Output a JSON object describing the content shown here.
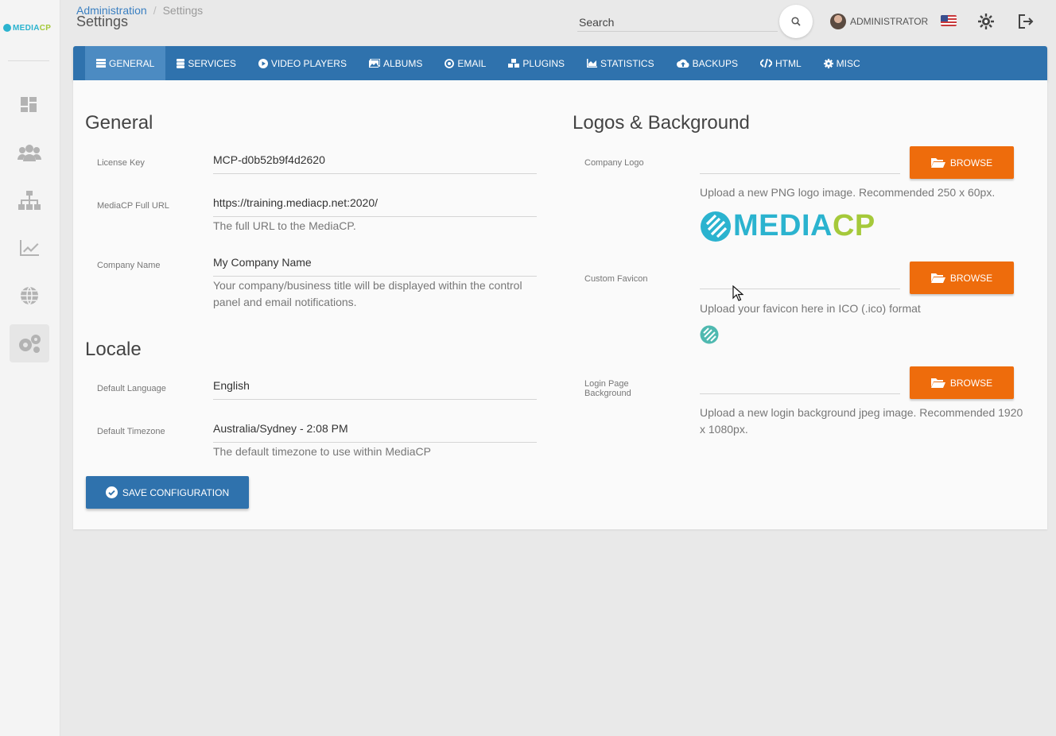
{
  "brand": {
    "name_part1": "MEDIA",
    "name_part2": "CP"
  },
  "sidebar": {
    "items": [
      {
        "name": "dashboard-icon"
      },
      {
        "name": "users-icon"
      },
      {
        "name": "sitemap-icon"
      },
      {
        "name": "chart-icon"
      },
      {
        "name": "globe-icon"
      },
      {
        "name": "cogs-icon",
        "active": true
      }
    ]
  },
  "header": {
    "breadcrumb_parent": "Administration",
    "breadcrumb_separator": "/",
    "breadcrumb_current": "Settings",
    "title": "Settings",
    "search_placeholder": "Search",
    "user_name": "ADMINISTRATOR"
  },
  "tabs": [
    {
      "label": "GENERAL",
      "icon": "list-icon",
      "active": true
    },
    {
      "label": "SERVICES",
      "icon": "server-icon"
    },
    {
      "label": "VIDEO PLAYERS",
      "icon": "play-icon"
    },
    {
      "label": "ALBUMS",
      "icon": "image-icon"
    },
    {
      "label": "EMAIL",
      "icon": "at-icon"
    },
    {
      "label": "PLUGINS",
      "icon": "cubes-icon"
    },
    {
      "label": "STATISTICS",
      "icon": "area-chart-icon"
    },
    {
      "label": "BACKUPS",
      "icon": "cloud-upload-icon"
    },
    {
      "label": "HTML",
      "icon": "code-icon"
    },
    {
      "label": "MISC",
      "icon": "cog-icon"
    }
  ],
  "general": {
    "title": "General",
    "license_key": {
      "label": "License Key",
      "value": "MCP-d0b52b9f4d2620"
    },
    "full_url": {
      "label": "MediaCP Full URL",
      "value": "https://training.mediacp.net:2020/",
      "help": "The full URL to the MediaCP."
    },
    "company_name": {
      "label": "Company Name",
      "value": "My Company Name",
      "help_line1": "Your company/business title will be displayed within the control",
      "help_line2": "panel and email notifications."
    }
  },
  "locale": {
    "title": "Locale",
    "language": {
      "label": "Default Language",
      "value": "English"
    },
    "timezone": {
      "label": "Default Timezone",
      "value": "Australia/Sydney - 2:08 PM",
      "help": "The default timezone to use within MediaCP"
    }
  },
  "save_label": "SAVE CONFIGURATION",
  "logos": {
    "title": "Logos & Background",
    "company_logo": {
      "label": "Company Logo",
      "browse": "BROWSE",
      "help": "Upload a new PNG logo image. Recommended 250 x 60px."
    },
    "favicon": {
      "label": "Custom Favicon",
      "browse": "BROWSE",
      "help": "Upload your favicon here in ICO (.ico) format"
    },
    "login_bg": {
      "label_line1": "Login Page",
      "label_line2": "Background",
      "browse": "BROWSE",
      "help_line1": "Upload a new login background jpeg image. Recommended 1920",
      "help_line2": "x 1080px."
    }
  },
  "colors": {
    "primary": "#2f72ad",
    "accent": "#ee6c0c",
    "brand_cyan": "#2bb3cf",
    "brand_green": "#a5c93a"
  }
}
